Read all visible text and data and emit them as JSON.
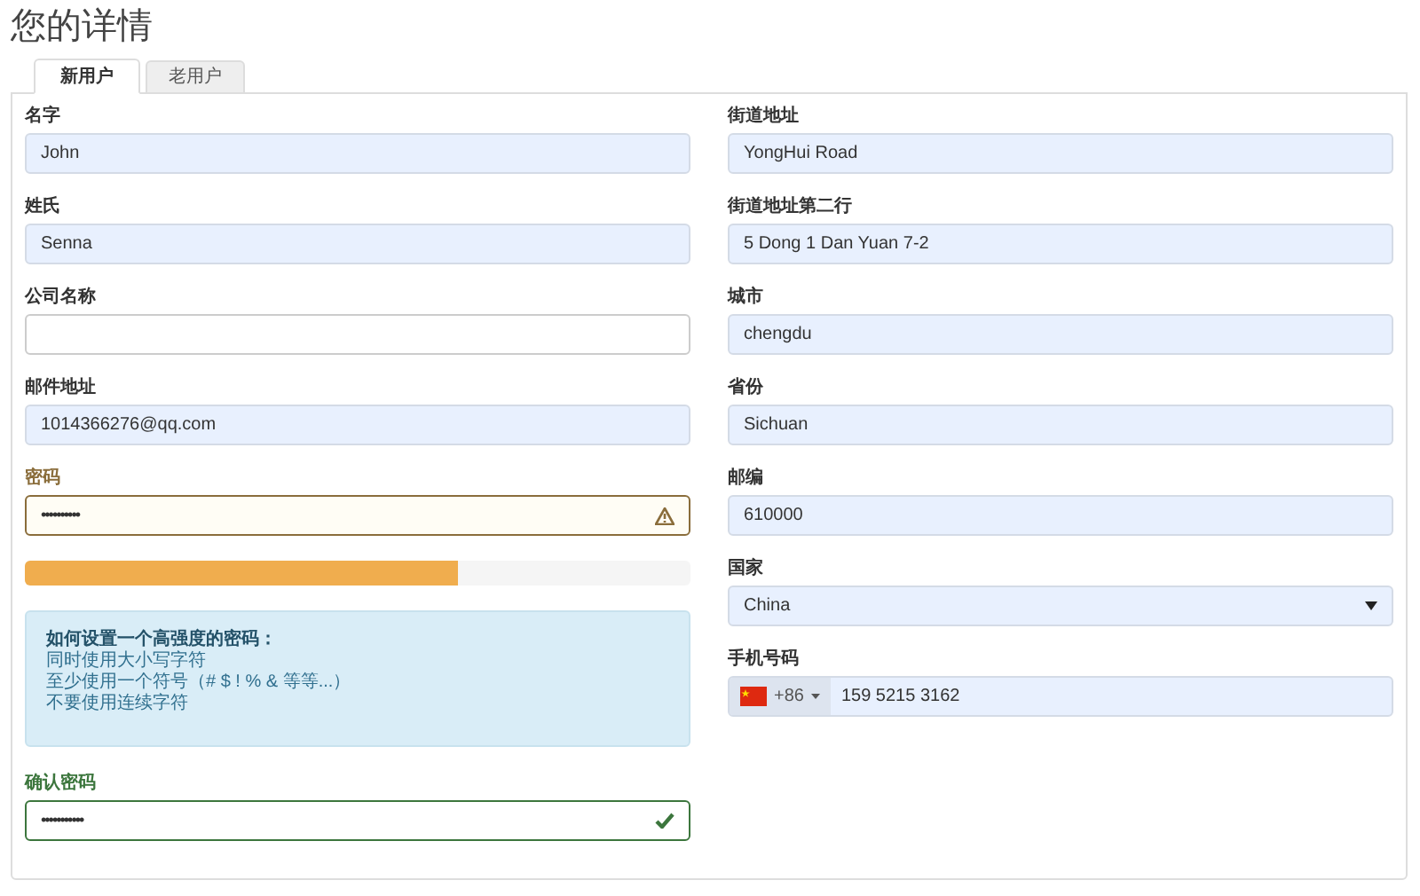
{
  "page_title": "您的详情",
  "tabs": [
    {
      "label": "新用户",
      "selected": true
    },
    {
      "label": "老用户",
      "selected": false
    }
  ],
  "left_column": [
    {
      "kind": "field",
      "label": "名字",
      "value": "John",
      "autofilled": true
    },
    {
      "kind": "field",
      "label": "姓氏",
      "value": "Senna",
      "autofilled": true
    },
    {
      "kind": "field",
      "label": "公司名称",
      "autofilled": false
    },
    {
      "kind": "field",
      "label": "邮件地址",
      "value": "1014366276@qq.com",
      "autofilled": true
    },
    {
      "kind": "password",
      "label": "密码",
      "value": "••••••••••",
      "warning": true,
      "success": false
    },
    {
      "kind": "meter",
      "level": 0.65
    },
    {
      "kind": "tip",
      "title": "如何设置一个高强度的密码：",
      "lines": [
        "同时使用大小写字符",
        "至少使用一个符号（# $ ! % & 等等...）",
        "不要使用连续字符"
      ]
    },
    {
      "kind": "password",
      "label": "确认密码",
      "value": "•••••••••••",
      "warning": false,
      "success": true
    }
  ],
  "right_column": [
    {
      "kind": "field",
      "label": "街道地址",
      "value": "YongHui Road",
      "autofilled": true
    },
    {
      "kind": "field",
      "label": "街道地址第二行",
      "value": "5 Dong 1 Dan Yuan 7-2",
      "autofilled": true
    },
    {
      "kind": "field",
      "label": "城市",
      "value": "chengdu",
      "autofilled": true
    },
    {
      "kind": "field",
      "label": "省份",
      "value": "Sichuan",
      "autofilled": true
    },
    {
      "kind": "field",
      "label": "邮编",
      "value": "610000",
      "autofilled": true
    },
    {
      "kind": "select",
      "label": "国家",
      "value": "China",
      "autofilled": true
    },
    {
      "kind": "phone",
      "label": "手机号码",
      "dial_code": "+86",
      "value": "159 5215 3162",
      "autofilled": true
    }
  ]
}
